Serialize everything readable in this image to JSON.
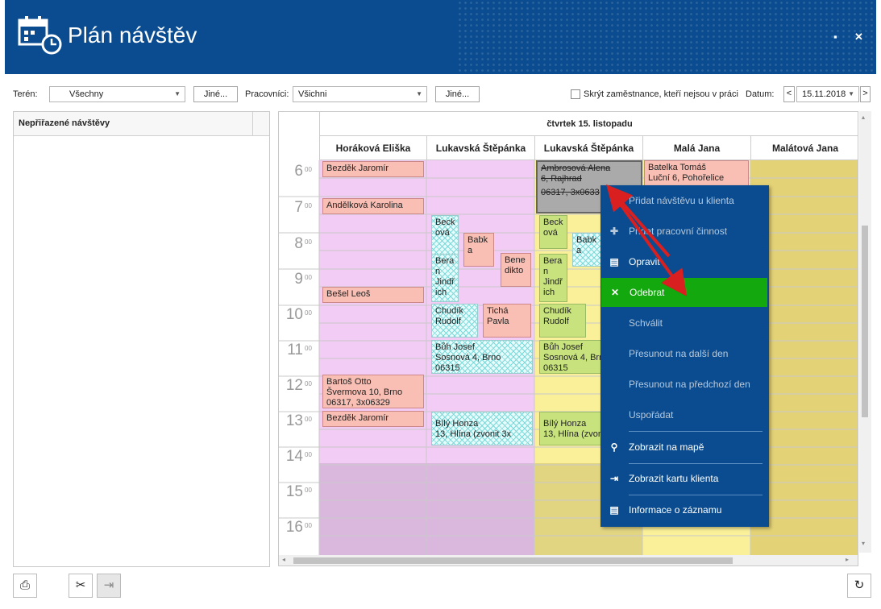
{
  "window": {
    "title": "Plán návštěv",
    "maximize": "▪",
    "close": "✕"
  },
  "filters": {
    "teren_label": "Terén:",
    "teren_value": "Všechny",
    "teren_other": "Jiné...",
    "pracovnici_label": "Pracovníci:",
    "pracovnici_value": "Všichni",
    "pracovnici_other": "Jiné...",
    "hide_label": "Skrýt zaměstnance, kteří nejsou v práci",
    "date_label": "Datum:",
    "date_value": "15.11.2018",
    "prev": "<",
    "next": ">"
  },
  "left_panel": {
    "title": "Nepřiřazené návštěvy"
  },
  "calendar": {
    "day": "čtvrtek 15. listopadu",
    "columns": [
      "Horáková Eliška",
      "Lukavská Štěpánka",
      "Lukavská Štěpánka",
      "Malá Jana",
      "Malátová Jana"
    ],
    "hours": [
      "6",
      "7",
      "8",
      "9",
      "10",
      "11",
      "12",
      "13",
      "14",
      "15",
      "16"
    ],
    "minutes": "00",
    "events": [
      {
        "col": 0,
        "lines": [
          "Bezděk Jaromír"
        ]
      },
      {
        "col": 0,
        "lines": [
          "Andělková Karolina"
        ]
      },
      {
        "col": 0,
        "lines": [
          "Bešel Leoš"
        ]
      },
      {
        "col": 0,
        "lines": [
          "Bartoš Otto",
          "Švermova 10, Brno",
          "06317, 3x06329"
        ]
      },
      {
        "col": 0,
        "lines": [
          "Bezděk Jaromír"
        ]
      },
      {
        "col": 1,
        "lines": [
          "Beck",
          "ová"
        ]
      },
      {
        "col": 1,
        "lines": [
          "Babk",
          "a"
        ]
      },
      {
        "col": 1,
        "lines": [
          "Bene",
          "dikto"
        ]
      },
      {
        "col": 1,
        "lines": [
          "Bera",
          "n",
          "Jindř",
          "ich"
        ]
      },
      {
        "col": 1,
        "lines": [
          "Chudík",
          "Rudolf"
        ]
      },
      {
        "col": 1,
        "lines": [
          "Tichá",
          "Pavla"
        ]
      },
      {
        "col": 1,
        "lines": [
          "Bůh Josef",
          "Sosnová 4, Brno",
          "06315"
        ]
      },
      {
        "col": 1,
        "lines": [
          "Bílý Honza",
          "13, Hlína (zvonit 3x"
        ]
      },
      {
        "col": 2,
        "lines": [
          "Ambrosová Alena",
          "6, Rajhrad",
          "06317, 3x0633"
        ]
      },
      {
        "col": 2,
        "lines": [
          "Beck",
          "ová"
        ]
      },
      {
        "col": 2,
        "lines": [
          "Babk",
          "a"
        ]
      },
      {
        "col": 2,
        "lines": [
          "Bera",
          "n",
          "Jindř",
          "ich"
        ]
      },
      {
        "col": 2,
        "lines": [
          "Chudík",
          "Rudolf"
        ]
      },
      {
        "col": 2,
        "lines": [
          "Bůh Josef",
          "Sosnová 4, Brno",
          "06315"
        ]
      },
      {
        "col": 2,
        "lines": [
          "Bílý Honza",
          "13, Hlína (zvonit"
        ]
      },
      {
        "col": 3,
        "lines": [
          "Batelka Tomáš",
          "Luční 6, Pohořelice"
        ]
      }
    ]
  },
  "context_menu": [
    {
      "icon": "✚",
      "label": "Přidat návštěvu u klienta",
      "state": "disabled"
    },
    {
      "icon": "✚",
      "label": "Přidat pracovní činnost",
      "state": "disabled"
    },
    {
      "icon": "▤",
      "label": "Opravit",
      "state": "normal"
    },
    {
      "icon": "✕",
      "label": "Odebrat",
      "state": "selected"
    },
    {
      "icon": "",
      "label": "Schválit",
      "state": "disabled"
    },
    {
      "icon": "",
      "label": "Přesunout na další den",
      "state": "disabled"
    },
    {
      "icon": "",
      "label": "Přesunout na předchozí den",
      "state": "disabled"
    },
    {
      "icon": "",
      "label": "Uspořádat",
      "state": "disabled"
    },
    {
      "icon": "⚲",
      "label": "Zobrazit na mapě",
      "state": "normal"
    },
    {
      "icon": "⇥",
      "label": "Zobrazit kartu klienta",
      "state": "normal"
    },
    {
      "icon": "▤",
      "label": "Informace o záznamu",
      "state": "normal"
    }
  ],
  "colors": {
    "header": "#0a4c8f",
    "menu": "#0a4c8f",
    "selected": "#12a80e",
    "pink": "#f9bfb4",
    "green": "#c8e37e",
    "lilac": "#f2ccf5",
    "yellow": "#fbf09a"
  },
  "toolbar": {
    "print": "print-icon",
    "settings": "tools-icon",
    "export": "export-icon",
    "refresh": "refresh-icon"
  }
}
